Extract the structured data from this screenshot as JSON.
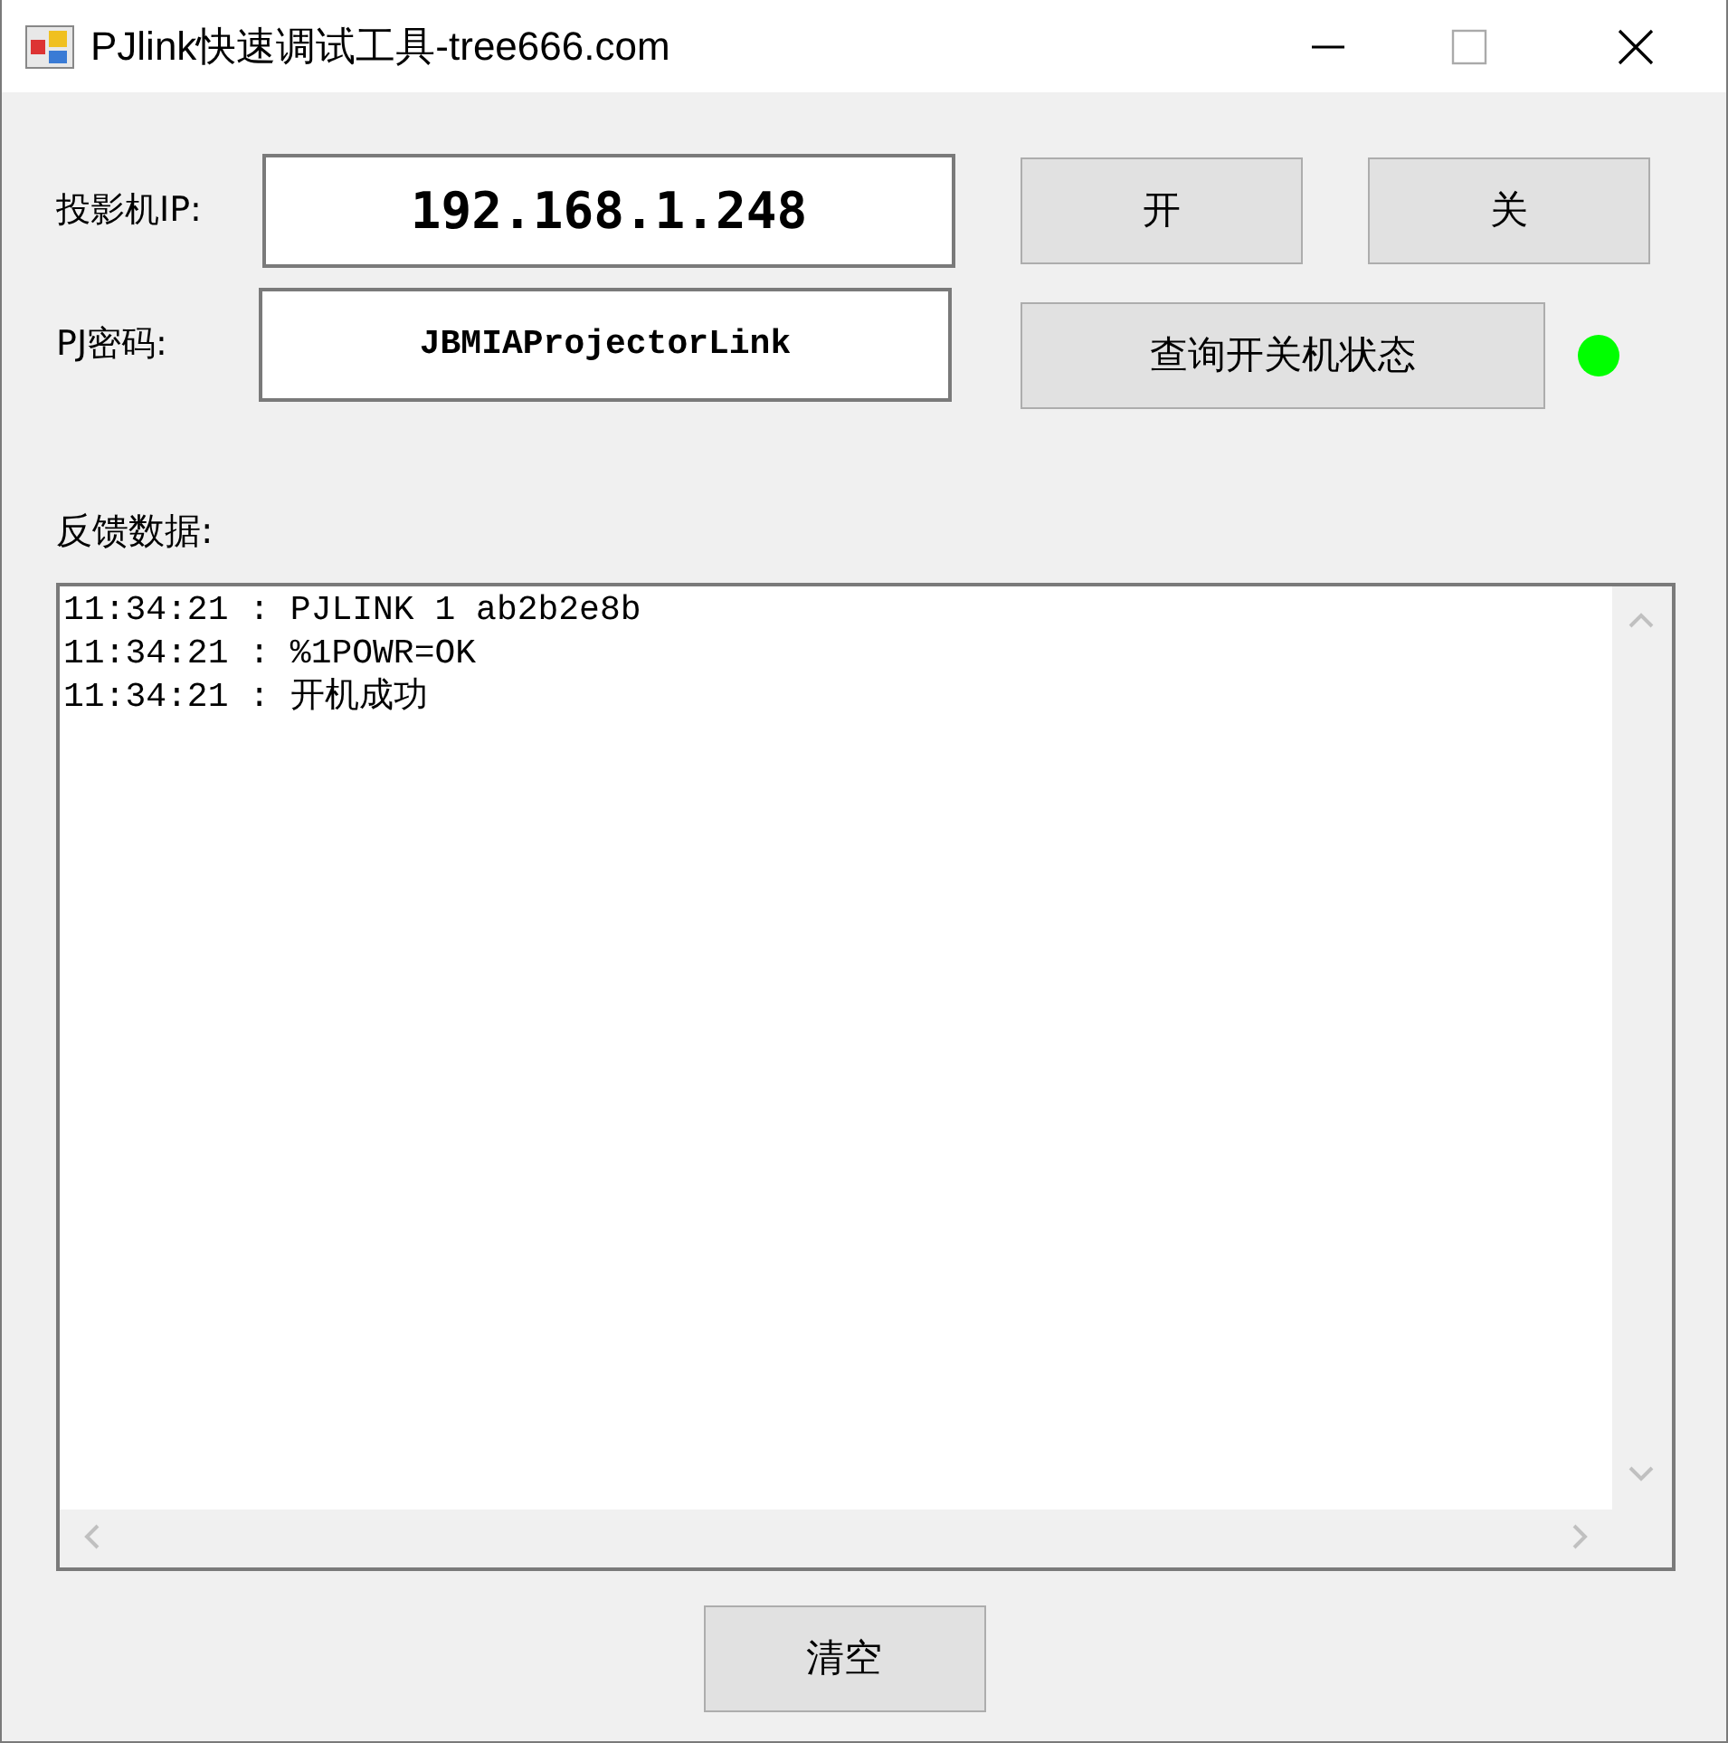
{
  "window": {
    "title": "PJlink快速调试工具-tree666.com"
  },
  "ip": {
    "label": "投影机IP:",
    "value": "192.168.1.248"
  },
  "password": {
    "label": "PJ密码:",
    "value": "JBMIAProjectorLink"
  },
  "buttons": {
    "on": "开",
    "off": "关",
    "query": "查询开关机状态",
    "clear": "清空"
  },
  "indicator": {
    "on": true
  },
  "log": {
    "label": "反馈数据:",
    "lines": [
      "11:34:21 : PJLINK 1 ab2b2e8b",
      "11:34:21 : %1POWR=OK",
      "11:34:21 : 开机成功"
    ]
  }
}
